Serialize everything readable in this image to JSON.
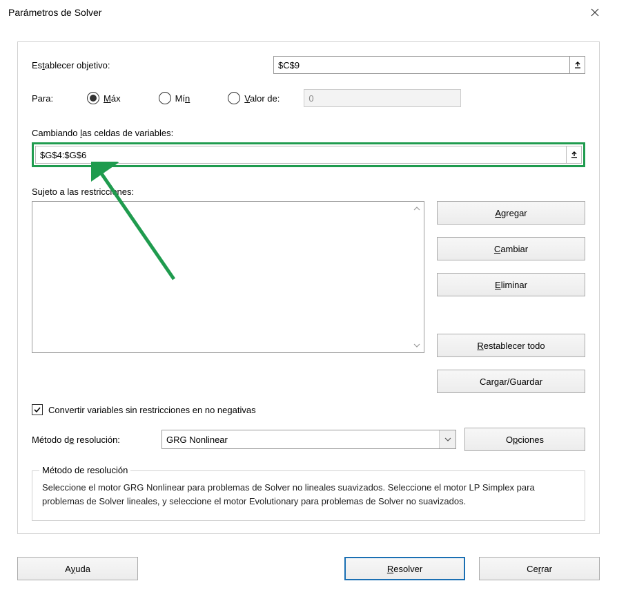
{
  "window": {
    "title": "Parámetros de Solver"
  },
  "objective": {
    "label_prefix": "Es",
    "label_u": "t",
    "label_suffix": "ablecer objetivo:",
    "value": "$C$9"
  },
  "para": {
    "label": "Para:",
    "max_u": "M",
    "max_suffix": "áx",
    "min_prefix": "Mí",
    "min_u": "n",
    "valor_u": "V",
    "valor_suffix": "alor de:",
    "value_input": "0",
    "selected": "max"
  },
  "variables": {
    "label_prefix": "Cambiando ",
    "label_u": "l",
    "label_suffix": "as celdas de variables:",
    "value": "$G$4:$G$6"
  },
  "constraints": {
    "label": "Sujeto a las restricciones:"
  },
  "buttons": {
    "agregar_u": "A",
    "agregar_suffix": "gregar",
    "cambiar_u": "C",
    "cambiar_suffix": "ambiar",
    "eliminar_u": "E",
    "eliminar_suffix": "liminar",
    "restablecer_u": "R",
    "restablecer_suffix": "establecer todo",
    "cargar_prefix": "Car",
    "cargar_u": "g",
    "cargar_suffix": "ar/Guardar",
    "opciones_prefix": "O",
    "opciones_u": "p",
    "opciones_suffix": "ciones",
    "ayuda_prefix": "A",
    "ayuda_u": "y",
    "ayuda_suffix": "uda",
    "resolver_u": "R",
    "resolver_suffix": "esolver",
    "cerrar_prefix": "Ce",
    "cerrar_u": "r",
    "cerrar_suffix": "rar"
  },
  "checkbox": {
    "label": "Convertir variables sin restricciones en no negativas",
    "checked": true
  },
  "method": {
    "label_prefix": "Método d",
    "label_u": "e",
    "label_suffix": " resolución:",
    "value": "GRG Nonlinear"
  },
  "description": {
    "legend": "Método de resolución",
    "text": "Seleccione el motor GRG Nonlinear para problemas de Solver no lineales suavizados. Seleccione el motor LP Simplex para problemas de Solver lineales, y seleccione el motor Evolutionary para problemas de Solver no suavizados."
  }
}
